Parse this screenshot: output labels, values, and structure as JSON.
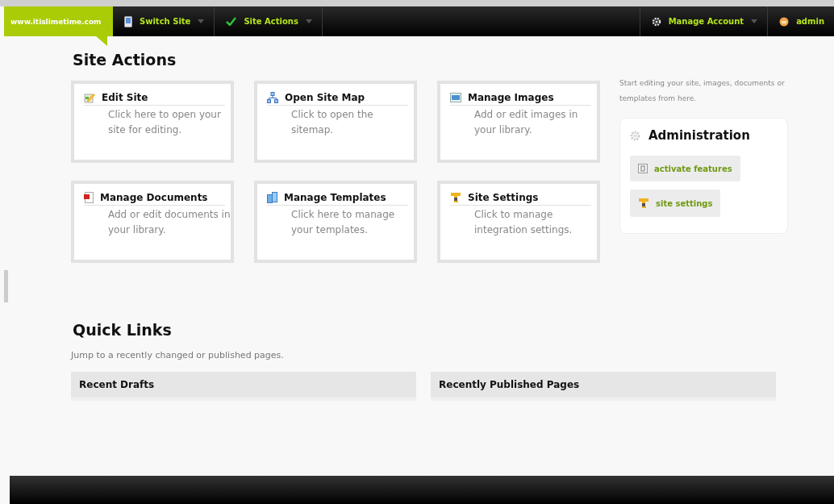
{
  "top_bar": {
    "site": "www.itislimetime.com",
    "menus": [
      {
        "label": "Switch Site"
      },
      {
        "label": "Site Actions"
      }
    ],
    "right_menus": [
      {
        "label": "Manage Account"
      },
      {
        "label": "admin"
      }
    ]
  },
  "site_actions": {
    "title": "Site Actions",
    "intro": "Start editing your site, images, documents or templates from here.",
    "cards": [
      {
        "title": "Edit Site",
        "description": "Click here to open your site for editing."
      },
      {
        "title": "Open Site Map",
        "description": "Click to open the sitemap."
      },
      {
        "title": "Manage Images",
        "description": "Add or edit images in your library."
      },
      {
        "title": "Manage Documents",
        "description": "Add or edit documents in your library."
      },
      {
        "title": "Manage Templates",
        "description": "Click here to manage your templates."
      },
      {
        "title": "Site Settings",
        "description": "Click to manage integration settings."
      }
    ]
  },
  "administration": {
    "title": "Administration",
    "links": [
      {
        "label": "activate features"
      },
      {
        "label": "site settings"
      }
    ]
  },
  "quick_links": {
    "title": "Quick Links",
    "intro": "Jump to a recently changed or published pages.",
    "panels": [
      {
        "title": "Recent Drafts"
      },
      {
        "title": "Recently Published Pages"
      }
    ]
  }
}
